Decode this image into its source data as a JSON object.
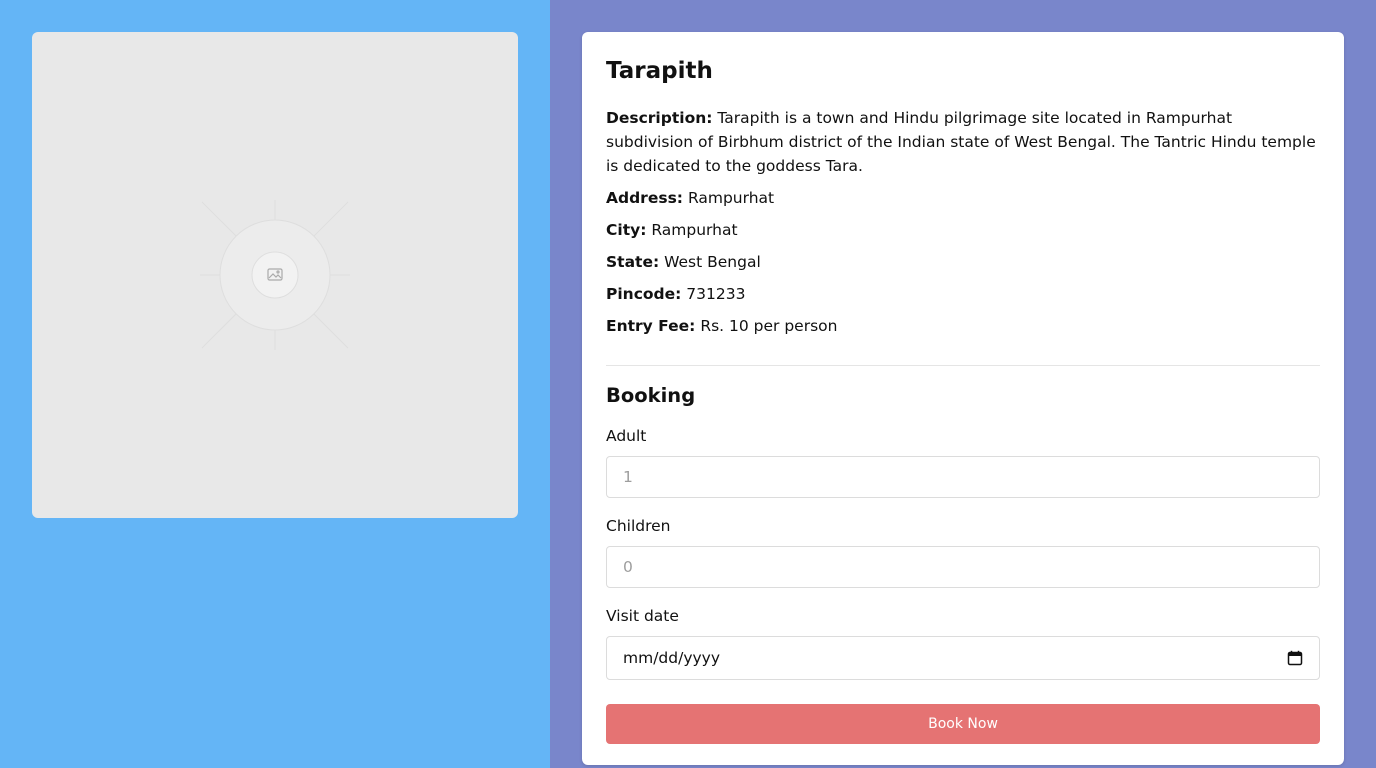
{
  "place": {
    "name": "Tarapith",
    "details": [
      {
        "label": "Description:",
        "value": "Tarapith is a town and Hindu pilgrimage site located in Rampurhat subdivision of Birbhum district of the Indian state of West Bengal. The Tantric Hindu temple is dedicated to the goddess Tara."
      },
      {
        "label": "Address:",
        "value": "Rampurhat"
      },
      {
        "label": "City:",
        "value": "Rampurhat"
      },
      {
        "label": "State:",
        "value": "West Bengal"
      },
      {
        "label": "Pincode:",
        "value": "731233"
      },
      {
        "label": "Entry Fee:",
        "value": "Rs. 10 per person"
      }
    ]
  },
  "booking": {
    "title": "Booking",
    "adult_label": "Adult",
    "adult_placeholder": "1",
    "children_label": "Children",
    "children_placeholder": "0",
    "visit_date_label": "Visit date",
    "visit_date_placeholder": "mm/dd/yyyy",
    "submit_label": "Book Now"
  },
  "icons": {
    "image_placeholder": "image-icon",
    "calendar": "calendar-icon"
  },
  "colors": {
    "left_background": "#64b5f6",
    "right_background": "#7986cb",
    "button": "#e57373"
  }
}
